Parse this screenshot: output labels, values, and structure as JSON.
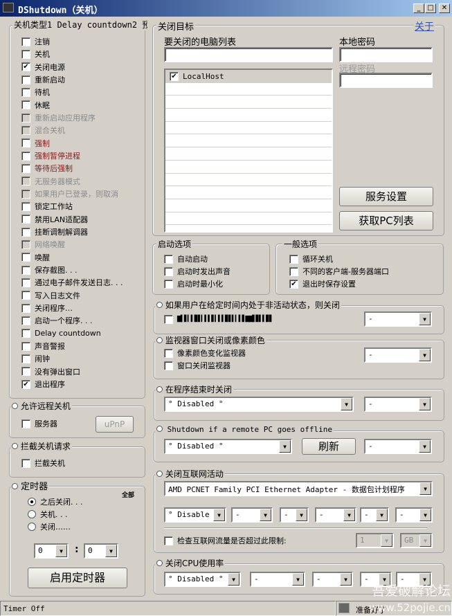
{
  "window": {
    "title": "DShutdown（关机）",
    "minimize": "_",
    "maximize": "□",
    "close": "✕"
  },
  "shutdown_types": {
    "title": "关机类型1 Delay countdown2 预",
    "items": [
      {
        "label": "注销",
        "checked": false,
        "state": "normal"
      },
      {
        "label": "关机",
        "checked": false,
        "state": "normal"
      },
      {
        "label": "关闭电源",
        "checked": true,
        "state": "normal"
      },
      {
        "label": "重新启动",
        "checked": false,
        "state": "normal"
      },
      {
        "label": "待机",
        "checked": false,
        "state": "normal"
      },
      {
        "label": "休眠",
        "checked": false,
        "state": "normal"
      },
      {
        "label": "重新启动应用程序",
        "checked": false,
        "state": "disabled"
      },
      {
        "label": "混合关机",
        "checked": false,
        "state": "disabled"
      },
      {
        "label": "强制",
        "checked": false,
        "state": "red"
      },
      {
        "label": "强制暂停进程",
        "checked": false,
        "state": "red"
      },
      {
        "label": "等待后强制",
        "checked": false,
        "state": "red"
      },
      {
        "label": "无服务器模式",
        "checked": false,
        "state": "disabled"
      },
      {
        "label": "如果用户已登录，则取消",
        "checked": false,
        "state": "disabled"
      },
      {
        "label": "锁定工作站",
        "checked": false,
        "state": "normal"
      },
      {
        "label": "禁用LAN适配器",
        "checked": false,
        "state": "normal"
      },
      {
        "label": "挂断调制解调器",
        "checked": false,
        "state": "normal"
      },
      {
        "label": "网络唤醒",
        "checked": false,
        "state": "disabled"
      },
      {
        "label": "唤醒",
        "checked": false,
        "state": "normal"
      },
      {
        "label": "保存截图. . .",
        "checked": false,
        "state": "normal"
      },
      {
        "label": "通过电子邮件发送日志. . .",
        "checked": false,
        "state": "normal"
      },
      {
        "label": "写入日志文件",
        "checked": false,
        "state": "normal"
      },
      {
        "label": "关闭程序…",
        "checked": false,
        "state": "normal"
      },
      {
        "label": "启动一个程序. . .",
        "checked": false,
        "state": "normal"
      },
      {
        "label": "Delay countdown",
        "checked": false,
        "state": "normal"
      },
      {
        "label": "声音警报",
        "checked": false,
        "state": "normal"
      },
      {
        "label": "闹钟",
        "checked": false,
        "state": "normal"
      },
      {
        "label": "没有弹出窗口",
        "checked": false,
        "state": "normal"
      },
      {
        "label": "退出程序",
        "checked": true,
        "state": "normal"
      }
    ]
  },
  "remote": {
    "title": "允许远程关机",
    "server_label": "服务器",
    "upnp_label": "uPnP"
  },
  "intercept": {
    "title": "拦截关机请求",
    "label": "拦截关机"
  },
  "timer": {
    "title": "定时器",
    "all_label": "全部",
    "options": [
      "之后关闭. . .",
      "关机. . .",
      "关闭……"
    ],
    "selected": 0,
    "hours": "0",
    "separator": ":",
    "minutes": "0",
    "start_label": "启用定时器"
  },
  "target": {
    "title": "关闭目标",
    "about_link": "关于",
    "pc_list_label": "要关闭的电脑列表",
    "pc_input": "",
    "pcs": [
      {
        "name": "LocalHost",
        "checked": true
      }
    ],
    "local_pw_label": "本地密码",
    "remote_pw_label": "远程密码",
    "service_btn": "服务设置",
    "get_pc_btn": "获取PC列表"
  },
  "startup": {
    "title": "启动选项",
    "items": [
      "自动启动",
      "启动时发出声音",
      "启动时最小化"
    ]
  },
  "general": {
    "title": "一般选项",
    "items": [
      {
        "label": "循环关机",
        "checked": false
      },
      {
        "label": "不同的客户端-服务器端口",
        "checked": false
      },
      {
        "label": "退出时保存设置",
        "checked": true
      }
    ]
  },
  "idle": {
    "title": "如果用户在给定时间内处于非活动状态，则关闭",
    "garbled": "▇▍▌▎▍▋▌▎▍▍▌▎▍▍▋▌▍▎▍▌▇▇▌▋▍▍▋▌",
    "value": "-"
  },
  "monitor": {
    "title": "监视器窗口关闭或像素颜色",
    "items": [
      "像素颜色变化监视器",
      "窗口关闭监视器"
    ],
    "value": "-"
  },
  "program_end": {
    "title": "在程序结束时关闭",
    "value": "°  Disabled °",
    "value2": "-"
  },
  "remote_offline": {
    "title": "Shutdown if a remote PC goes offline",
    "value": "°  Disabled °",
    "refresh_btn": "刷新",
    "value2": "-"
  },
  "internet": {
    "title": "关闭互联网活动",
    "adapter": "AMD PCNET Family PCI Ethernet Adapter - 数据包计划程序",
    "values": [
      "°  Disable",
      "-",
      "-",
      "-",
      "-",
      "-"
    ],
    "traffic_label": "检查互联网流量是否超过此限制:",
    "traffic_value": "1",
    "traffic_unit": "GB"
  },
  "cpu": {
    "title": "关闭CPU使用率",
    "values": [
      "°  Disabled °",
      "-",
      "-",
      "-",
      "-"
    ]
  },
  "status": {
    "left": "Timer Off",
    "right": "准备好了"
  },
  "watermark": {
    "line1": "吾爱破解论坛",
    "line2": "www.52pojie.cn"
  }
}
